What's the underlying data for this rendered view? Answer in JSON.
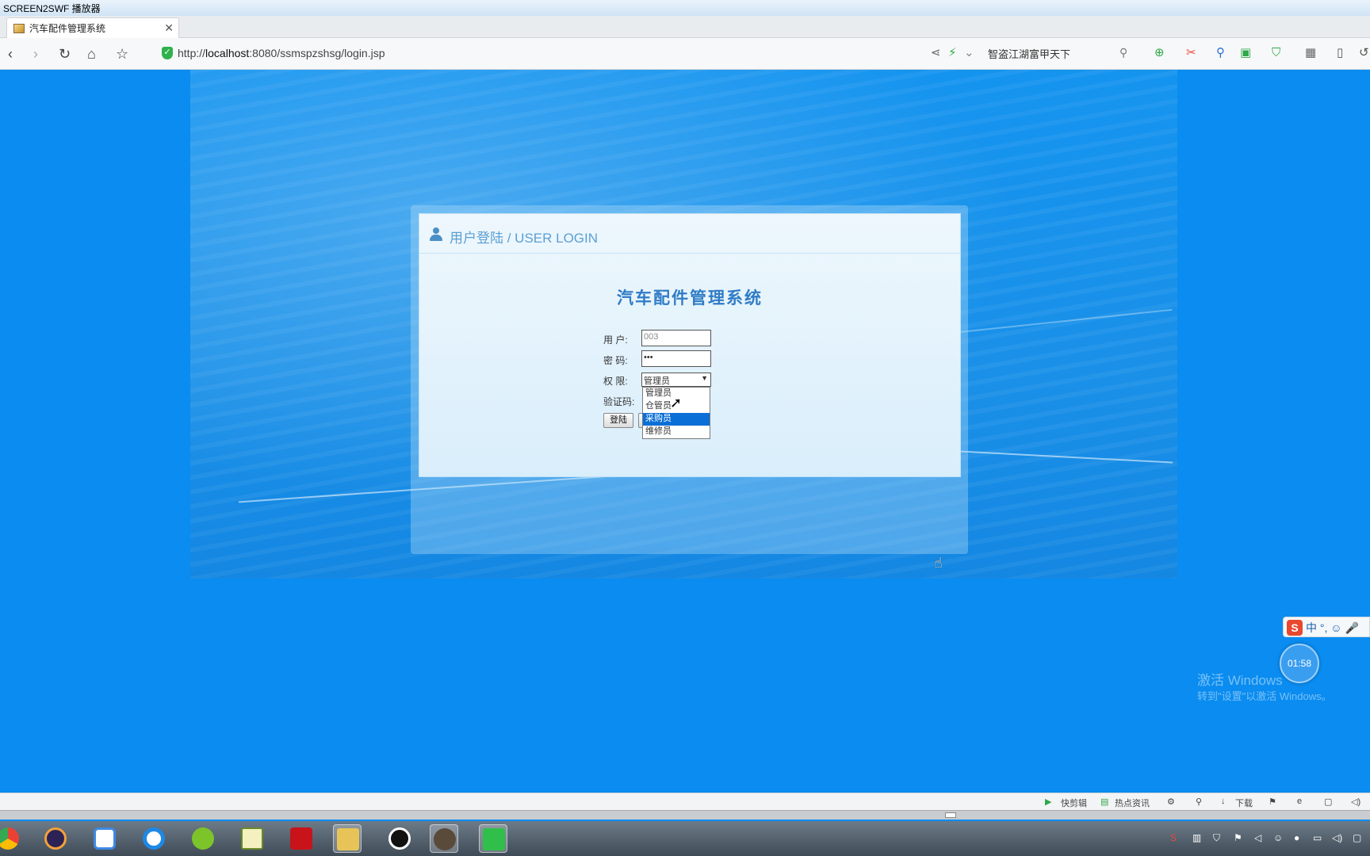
{
  "player": {
    "title": "SCREEN2SWF 播放器"
  },
  "browser": {
    "tab_title": "汽车配件管理系统",
    "url_prefix": "http://",
    "url_host": "localhost",
    "url_rest": ":8080/ssmspzshsg/login.jsp",
    "search_text": "智盗江湖富甲天下"
  },
  "login": {
    "header": "用户登陆 / USER LOGIN",
    "system_title": "汽车配件管理系统",
    "user_label": "用  户:",
    "user_value": "003",
    "password_label": "密  码:",
    "password_value": "•••",
    "role_label": "权  限:",
    "role_selected": "管理员",
    "role_options": [
      "管理员",
      "仓管员",
      "采购员",
      "维修员"
    ],
    "captcha_label": "验证码:",
    "login_button": "登陆"
  },
  "widgets": {
    "timer": "01:58",
    "ime_label": "中",
    "watermark_line1": "激活 Windows",
    "watermark_line2": "转到\"设置\"以激活 Windows。"
  },
  "statusbar": {
    "items": [
      "快剪辑",
      "热点资讯",
      "下载"
    ]
  }
}
